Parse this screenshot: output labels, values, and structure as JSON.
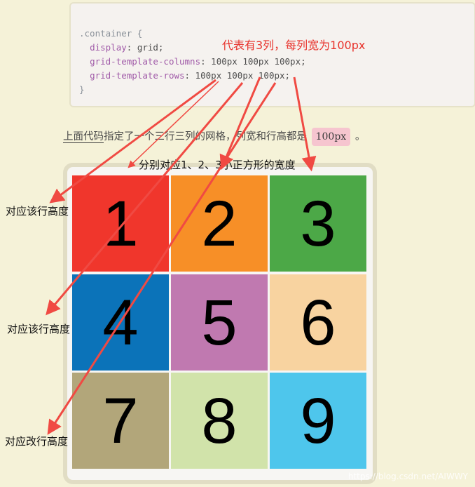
{
  "code": {
    "selector": ".container",
    "open_brace": "{",
    "close_brace": "}",
    "lines": [
      {
        "property": "display",
        "value": "grid;"
      },
      {
        "property": "grid-template-columns",
        "value": "100px 100px 100px;"
      },
      {
        "property": "grid-template-rows",
        "value": "100px 100px 100px;"
      }
    ]
  },
  "annotations": {
    "columns_note": "代表有3列，每列宽为100px",
    "widths_note": "分别对应1、2、3小正方形的宽度",
    "row_note_1": "对应该行高度",
    "row_note_2": "对应该行高度",
    "row_note_3": "对应改行高度"
  },
  "description": {
    "underlined": "上面代码",
    "middle": "指定了一个三行三列的网格，列宽和行高都是",
    "pill": "100px",
    "end": "。"
  },
  "grid": {
    "cells": [
      {
        "label": "1",
        "color": "#f0362c"
      },
      {
        "label": "2",
        "color": "#f78f27"
      },
      {
        "label": "3",
        "color": "#4ca847"
      },
      {
        "label": "4",
        "color": "#0b73b9"
      },
      {
        "label": "5",
        "color": "#c079b0"
      },
      {
        "label": "6",
        "color": "#f8d3a0"
      },
      {
        "label": "7",
        "color": "#b2a67a"
      },
      {
        "label": "8",
        "color": "#d1e3aa"
      },
      {
        "label": "9",
        "color": "#4ec6ec"
      }
    ]
  },
  "watermark": "https://blog.csdn.net/AIWWY",
  "colors": {
    "annotation_red": "#e8332c",
    "arrow_red": "#f04a43"
  }
}
